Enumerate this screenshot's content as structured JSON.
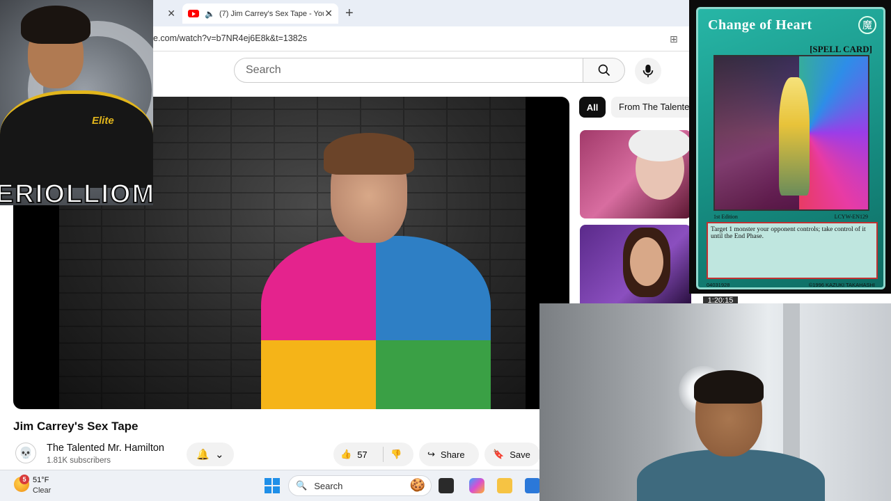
{
  "browser": {
    "tab_title": "(7) Jim Carrey's Sex Tape - You",
    "url": "e.com/watch?v=b7NR4ej6E8k&t=1382s"
  },
  "youtube": {
    "search_placeholder": "Search",
    "video_title": "Jim Carrey's Sex Tape",
    "channel_name": "The Talented Mr. Hamilton",
    "subscribers": "1.81K subscribers",
    "likes": "57",
    "share_label": "Share",
    "save_label": "Save",
    "chips": [
      "All",
      "From The Talente"
    ],
    "rec_timestamp": "1:20:15"
  },
  "overlay": {
    "text": "ERIOLLIOM",
    "badge": "Elite"
  },
  "card": {
    "name": "Change of Heart",
    "type": "[SPELL CARD]",
    "attribute_symbol": "魔",
    "edition": "1st Edition",
    "set_number": "LCYW-EN129",
    "effect": "Target 1 monster your opponent controls; take control of it until the End Phase.",
    "id": "04031928",
    "copyright": "©1996 KAZUKI TAKAHASHI"
  },
  "taskbar": {
    "weather_badge": "5",
    "temperature": "51°F",
    "condition": "Clear",
    "search_label": "Search"
  },
  "icons": {
    "tab_close": "✕",
    "new_tab": "+",
    "back": "←",
    "chevron": "⌄"
  },
  "colors": {
    "youtube_red": "#ff0000",
    "card_teal": "#15897e",
    "taskbar": "#eef1f6"
  }
}
